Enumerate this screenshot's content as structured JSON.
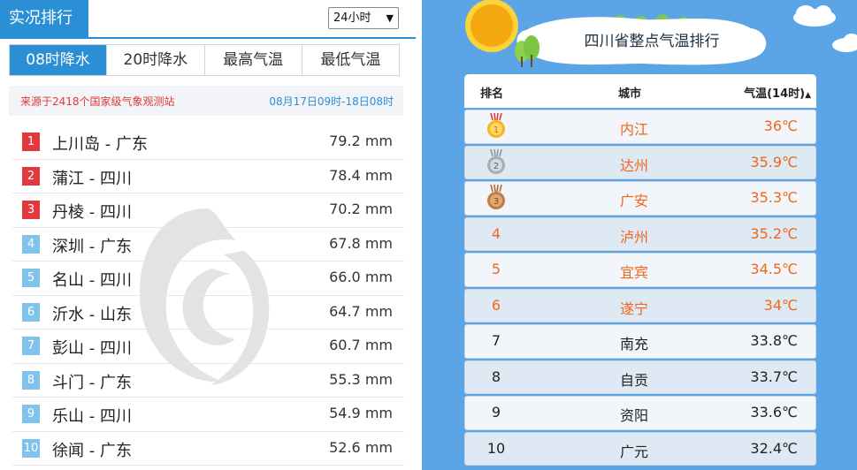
{
  "left": {
    "title": "实况排行",
    "period_select": "24小时",
    "tabs": [
      {
        "label": "08时降水",
        "active": true
      },
      {
        "label": "20时降水",
        "active": false
      },
      {
        "label": "最高气温",
        "active": false
      },
      {
        "label": "最低气温",
        "active": false
      }
    ],
    "source": "来源于2418个国家级气象观测站",
    "date_range": "08月17日09时-18日08时",
    "rows": [
      {
        "rank": "1",
        "name": "上川岛 - 广东",
        "value": "79.2 mm"
      },
      {
        "rank": "2",
        "name": "蒲江 - 四川",
        "value": "78.4 mm"
      },
      {
        "rank": "3",
        "name": "丹棱 - 四川",
        "value": "70.2 mm"
      },
      {
        "rank": "4",
        "name": "深圳 - 广东",
        "value": "67.8 mm"
      },
      {
        "rank": "5",
        "name": "名山 - 四川",
        "value": "66.0 mm"
      },
      {
        "rank": "6",
        "name": "沂水 - 山东",
        "value": "64.7 mm"
      },
      {
        "rank": "7",
        "name": "彭山 - 四川",
        "value": "60.7 mm"
      },
      {
        "rank": "8",
        "name": "斗门 - 广东",
        "value": "55.3 mm"
      },
      {
        "rank": "9",
        "name": "乐山 - 四川",
        "value": "54.9 mm"
      },
      {
        "rank": "10",
        "name": "徐闻 - 广东",
        "value": "52.6 mm"
      }
    ]
  },
  "right": {
    "title": "四川省整点气温排行",
    "headers": {
      "rank": "排名",
      "city": "城市",
      "temp": "气温(14时)",
      "sort_icon": "sort-up-icon"
    },
    "rows": [
      {
        "rank": "1",
        "medal": "gold-medal-icon",
        "city": "内江",
        "temp": "36℃",
        "highlight": true
      },
      {
        "rank": "2",
        "medal": "silver-medal-icon",
        "city": "达州",
        "temp": "35.9℃",
        "highlight": true
      },
      {
        "rank": "3",
        "medal": "bronze-medal-icon",
        "city": "广安",
        "temp": "35.3℃",
        "highlight": true
      },
      {
        "rank": "4",
        "city": "泸州",
        "temp": "35.2℃",
        "highlight": true
      },
      {
        "rank": "5",
        "city": "宜宾",
        "temp": "34.5℃",
        "highlight": true
      },
      {
        "rank": "6",
        "city": "遂宁",
        "temp": "34℃",
        "highlight": true
      },
      {
        "rank": "7",
        "city": "南充",
        "temp": "33.8℃",
        "highlight": false
      },
      {
        "rank": "8",
        "city": "自贡",
        "temp": "33.7℃",
        "highlight": false
      },
      {
        "rank": "9",
        "city": "资阳",
        "temp": "33.6℃",
        "highlight": false
      },
      {
        "rank": "10",
        "city": "广元",
        "temp": "32.4℃",
        "highlight": false
      }
    ]
  },
  "colors": {
    "accent_blue": "#2b8fd6",
    "top_rank_red": "#e2393f",
    "rank_light_blue": "#7fc3ea",
    "source_red": "#e03a3a",
    "hot_orange": "#f2661b",
    "sky_blue": "#5ba5e6"
  }
}
